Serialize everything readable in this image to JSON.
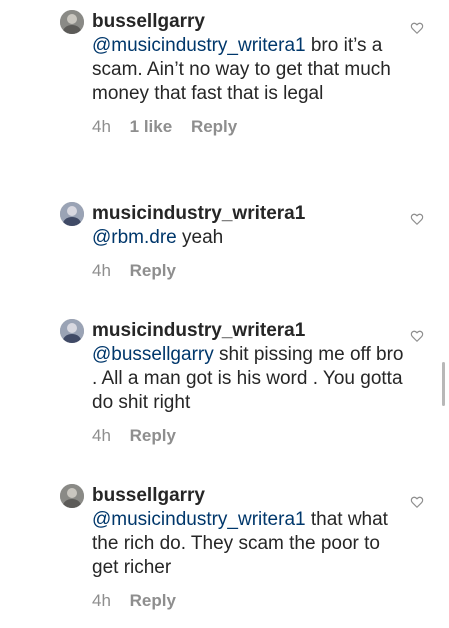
{
  "comments": [
    {
      "username": "bussellgarry",
      "mention": "@musicindustry_writera1",
      "text": " bro it’s a scam. Ain’t no way to get that much money that fast that is legal",
      "time": "4h",
      "likes": "1 like",
      "reply": "Reply"
    },
    {
      "username": "musicindustry_writera1",
      "mention": "@rbm.dre",
      "text": " yeah",
      "time": "4h",
      "reply": "Reply"
    },
    {
      "username": "musicindustry_writera1",
      "mention": "@bussellgarry",
      "text": " shit pissing me off bro . All a man got is his word . You gotta do shit right",
      "time": "4h",
      "reply": "Reply"
    },
    {
      "username": "bussellgarry",
      "mention": "@musicindustry_writera1",
      "text": " that what the rich do. They scam the poor to get richer",
      "time": "4h",
      "reply": "Reply"
    }
  ],
  "icons": {
    "like": "heart-outline-icon",
    "avatar": "profile-photo"
  },
  "colors": {
    "text": "#262626",
    "mention": "#00376b",
    "meta": "#8e8e8e"
  }
}
